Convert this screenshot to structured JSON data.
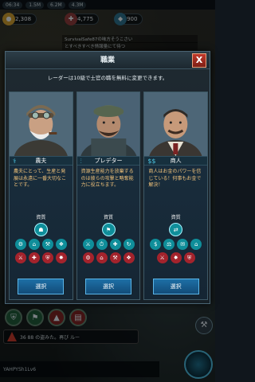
{
  "topbar": {
    "items": [
      "06:34",
      "1.5M",
      "6.2M",
      "4.3M"
    ]
  },
  "resources": {
    "left_value": "2,308",
    "middle_value": "4,775",
    "right_value": "900"
  },
  "chat": {
    "line1": "SurvivalSafe87の味方そうこさい",
    "line2": "とすべきすべき情報量にて待つ"
  },
  "modal": {
    "title": "職業",
    "close_label": "X",
    "notice": "レーダーは10級で士官の職を無料に変更できます。"
  },
  "cards": [
    {
      "name": "農夫",
      "icon": "farmer-icon",
      "description": "農夫にとって、生産と発展は永遠に一番大切なことです。",
      "traits_title": "資質",
      "select_label": "選択"
    },
    {
      "name": "プレデター",
      "icon": "predator-icon",
      "description": "資源生産能力を放棄するのは彼らの攻撃と略奪能力に役立ちます。",
      "traits_title": "資質",
      "select_label": "選択"
    },
    {
      "name": "商人",
      "icon": "merchant-icon",
      "description": "商人はお金のパワーを信じている！何事もお金で解決！",
      "traits_title": "資質",
      "select_label": "選択"
    }
  ],
  "bottom": {
    "warn_text": "36 88  の盗みた。再び ルー",
    "player_text": "YAHPYSh1Lv6"
  },
  "colors": {
    "accent_teal": "#0f8e9a",
    "accent_red": "#a3232c",
    "desc_text": "#f0c27a",
    "button_blue": "#1d6fa6"
  }
}
